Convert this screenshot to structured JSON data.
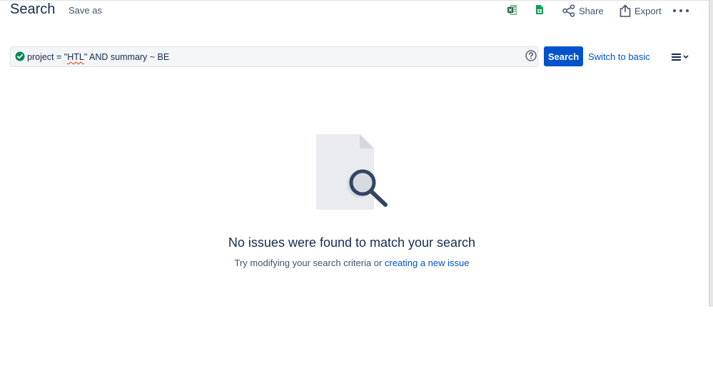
{
  "header": {
    "title": "Search",
    "save_as_label": "Save as",
    "share_label": "Share",
    "export_label": "Export",
    "excel_icon": "excel-icon",
    "sheets_icon": "google-sheets-icon",
    "share_icon": "share-icon",
    "export_icon": "export-icon",
    "more_icon": "more-dots-icon"
  },
  "query": {
    "status_icon": "check-circle-icon",
    "prefix": "project = \"",
    "project_key": "HTL",
    "suffix": "\" AND summary ~ BE",
    "help_icon": "help-icon"
  },
  "actions": {
    "search_label": "Search",
    "switch_label": "Switch to basic",
    "layout_icon": "list-view-menu-icon"
  },
  "empty_state": {
    "illustration": "document-magnifier-icon",
    "title": "No issues were found to match your search",
    "hint_prefix": "Try modifying your search criteria or ",
    "hint_link": "creating a new issue"
  },
  "colors": {
    "primary": "#0052cc",
    "text": "#172b4d",
    "subtle_text": "#42526e",
    "valid": "#00875a",
    "excel": "#1d6f42",
    "sheets": "#0f9d58"
  }
}
